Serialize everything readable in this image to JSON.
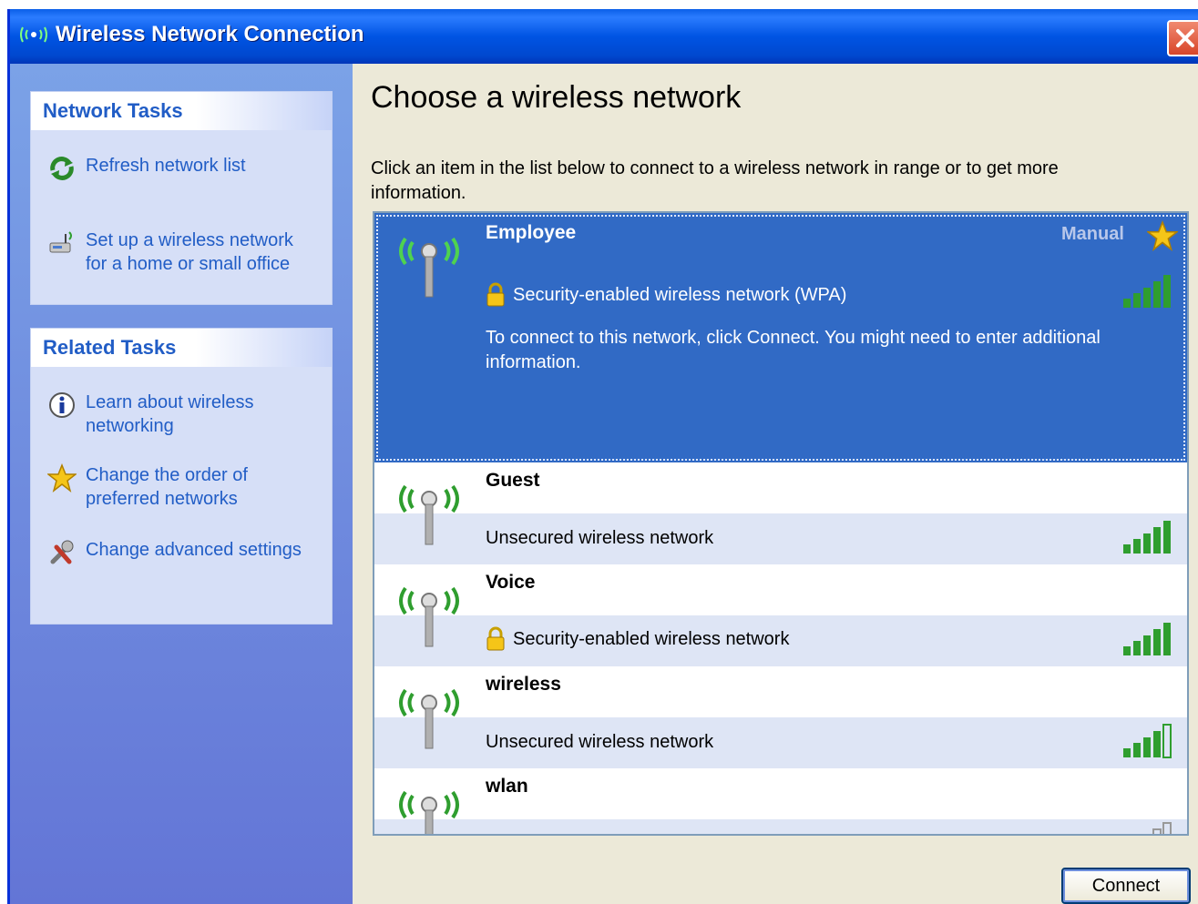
{
  "window": {
    "title": "Wireless Network Connection",
    "icon": "wireless-antenna-icon"
  },
  "sidebar": {
    "network_tasks": {
      "title": "Network Tasks",
      "items": [
        {
          "label": "Refresh network list",
          "icon": "refresh-icon"
        },
        {
          "label": "Set up a wireless network for a home or small office",
          "icon": "setup-wireless-icon"
        }
      ]
    },
    "related_tasks": {
      "title": "Related Tasks",
      "items": [
        {
          "label": "Learn about wireless networking",
          "icon": "info-icon"
        },
        {
          "label": "Change the order of preferred networks",
          "icon": "star-icon"
        },
        {
          "label": "Change advanced settings",
          "icon": "tools-icon"
        }
      ]
    }
  },
  "main": {
    "heading": "Choose a wireless network",
    "instruction": "Click an item in the list below to connect to a wireless network in range or to get more information.",
    "networks": [
      {
        "name": "Employee",
        "badge": "Manual",
        "security": "Security-enabled wireless network (WPA)",
        "info": "To connect to this network, click Connect. You might need to enter additional information.",
        "secured": true,
        "selected": true,
        "signal_bars": 5
      },
      {
        "name": "Guest",
        "security": "Unsecured wireless network",
        "secured": false,
        "signal_bars": 5
      },
      {
        "name": "Voice",
        "security": "Security-enabled wireless network",
        "secured": true,
        "signal_bars": 5
      },
      {
        "name": "wireless",
        "security": "Unsecured wireless network",
        "secured": false,
        "signal_bars": 4
      },
      {
        "name": "wlan",
        "security": "",
        "secured": false,
        "signal_bars": 1
      }
    ],
    "connect_label": "Connect"
  },
  "colors": {
    "titlebar": "#0054e3",
    "sidebar": "#6f8ddf",
    "selection": "#316ac5",
    "task_link": "#215dc6",
    "signal_green": "#2f9e2f"
  }
}
